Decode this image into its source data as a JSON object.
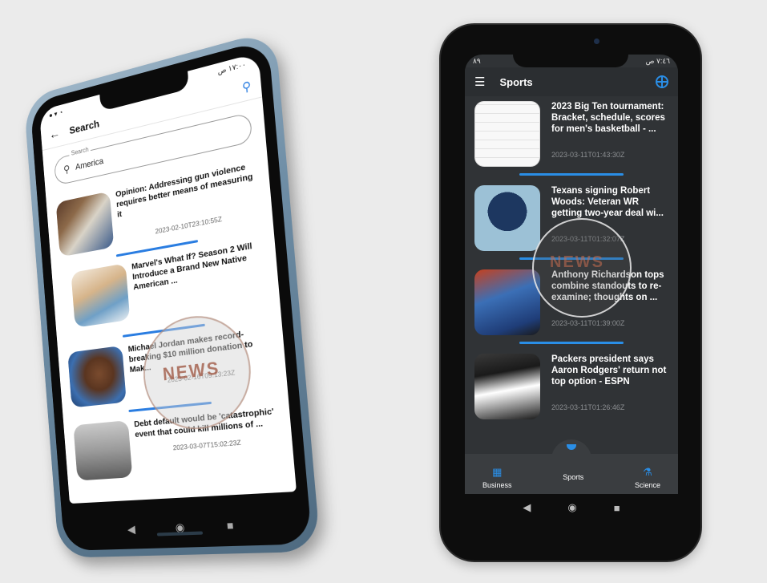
{
  "left_phone": {
    "status": {
      "time": "١٧:٠٠ ص",
      "left_icons": ""
    },
    "appbar": {
      "back_icon": "arrow-left",
      "title": "Search",
      "search_icon": "search"
    },
    "search_field": {
      "label": "Search",
      "value": "America"
    },
    "articles": [
      {
        "title": "Opinion: Addressing gun violence requires better means of measuring it",
        "date": "2023-02-10T23:10:55Z"
      },
      {
        "title": "Marvel's What If? Season 2 Will Introduce a Brand New Native American ...",
        "date": ""
      },
      {
        "title": "Michael Jordan makes record-breaking $10 million donation to Mak...",
        "date": "2023-02-16T09:13:23Z"
      },
      {
        "title": "Debt default would be 'catastrophic' event that could kill millions of ...",
        "date": "2023-03-07T15:02:23Z"
      }
    ],
    "watermark": "NEWS"
  },
  "right_phone": {
    "status": {
      "left": "٨٩",
      "right": "٧:٤٦ ص"
    },
    "appbar": {
      "title": "Sports",
      "menu_icon": "menu",
      "action_icon": "basketball"
    },
    "articles": [
      {
        "title": "2023 Big Ten tournament: Bracket, schedule, scores for men's basketball - ...",
        "date": "2023-03-11T01:43:30Z"
      },
      {
        "title": "Texans signing Robert Woods: Veteran WR getting two-year deal wi...",
        "date": "2023-03-11T01:32:07Z"
      },
      {
        "title": "Anthony Richardson tops combine standouts to re-examine; thoughts on ...",
        "date": "2023-03-11T01:39:00Z"
      },
      {
        "title": "Packers president says Aaron Rodgers' return not top option - ESPN",
        "date": "2023-03-11T01:26:46Z"
      }
    ],
    "watermark": "NEWS",
    "bottom_tabs": [
      {
        "label": "Business",
        "icon": "building"
      },
      {
        "label": "Sports",
        "icon": "basketball"
      },
      {
        "label": "Science",
        "icon": "flask"
      }
    ]
  },
  "colors": {
    "accent": "#2a8ee6",
    "dark_bg": "#303336",
    "light_bg": "#ffffff"
  }
}
